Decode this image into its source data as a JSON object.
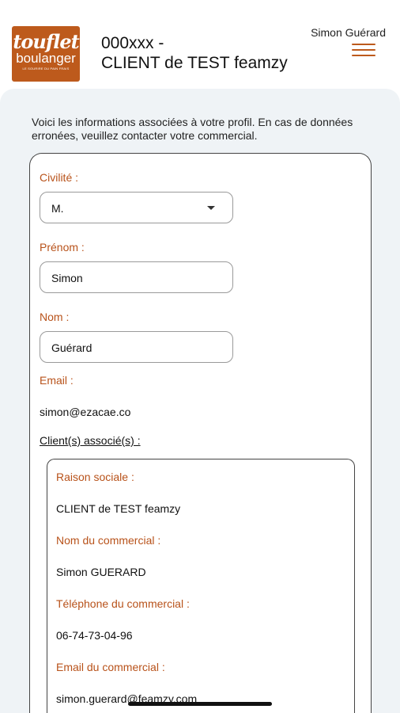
{
  "header": {
    "logo_line1": "touflet",
    "logo_line2": "boulanger",
    "logo_tagline": "LE SOURIRE DU PAIN FRAIS",
    "title_line1": "000xxx -",
    "title_line2": "CLIENT de TEST feamzy",
    "user_name": "Simon Guérard",
    "menu_icon": "hamburger-icon"
  },
  "colors": {
    "accent": "#bd5a1c",
    "sheet_bg": "#eff3f6"
  },
  "intro": "Voici les informations associées à votre profil. En cas de données erronées, veuillez contacter votre commercial.",
  "profile": {
    "civilite_label": "Civilité :",
    "civilite_value": "M.",
    "prenom_label": "Prénom :",
    "prenom_value": "Simon",
    "nom_label": "Nom :",
    "nom_value": "Guérard",
    "email_label": "Email :",
    "email_value": "simon@ezacae.co",
    "clients_label": "Client(s) associé(s) :"
  },
  "client": {
    "raison_label": "Raison sociale :",
    "raison_value": "CLIENT de TEST feamzy",
    "commercial_label": "Nom du commercial :",
    "commercial_value": "Simon GUERARD",
    "tel_label": "Téléphone du commercial :",
    "tel_value": "06-74-73-04-96",
    "email_label": "Email du commercial :",
    "email_value": "simon.guerard@feamzy.com"
  }
}
